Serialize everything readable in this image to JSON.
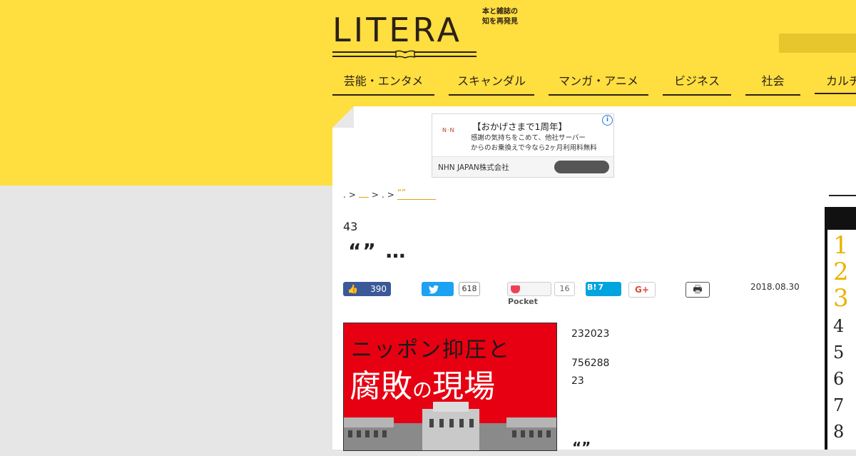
{
  "header": {
    "logo": "LITERA",
    "tagline_1": "本と雑誌の",
    "tagline_2": "知を再発見"
  },
  "nav": {
    "items": [
      "芸能・エンタメ",
      "スキャンダル",
      "マンガ・アニメ",
      "ビジネス",
      "社会",
      "カルチャー"
    ]
  },
  "ad": {
    "title": "【おかげさまで1周年】",
    "body_1": "感謝の気持ちをこめて、他社サーバー",
    "body_2": "からのお乗換えで今なら2ヶ月利用料無料",
    "company": "NHN JAPAN株式会社",
    "logo_text": "N·N",
    "info_icon": "i"
  },
  "breadcrumb": {
    "dot": ".",
    "sep": ">",
    "link_1": "",
    "link_2": "“”"
  },
  "article": {
    "kicker": "43",
    "headline": "“” …",
    "date": "2018.08.30",
    "paragraphs": [
      "232023",
      "756288",
      "23"
    ],
    "quote": "“”"
  },
  "share": {
    "facebook_count": "390",
    "twitter_count": "618",
    "pocket_label": "Pocket",
    "pocket_count": "16",
    "hatena_label": "B!",
    "hatena_count": "7",
    "gplus_label": "G+"
  },
  "cover": {
    "line_1": "ニッポン抑圧と",
    "line_2a": "腐敗",
    "line_2b": "の",
    "line_2c": "現場"
  },
  "ranking": {
    "numbers": [
      "1",
      "2",
      "3",
      "4",
      "5",
      "6",
      "7",
      "8"
    ]
  },
  "colors": {
    "brand_yellow": "#ffde40",
    "link_gold": "#e0a400",
    "facebook": "#3b5998",
    "twitter": "#1da1f2",
    "hatena": "#00a4de"
  }
}
